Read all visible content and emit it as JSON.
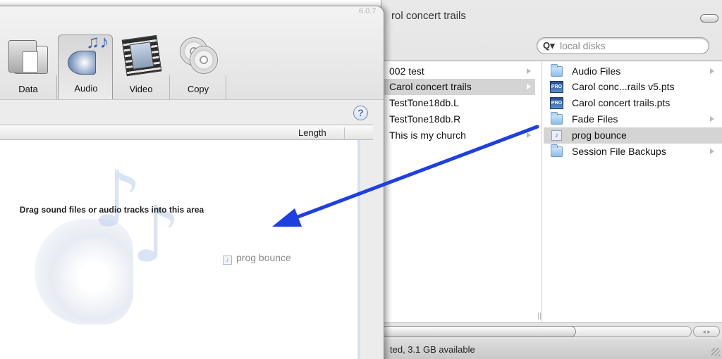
{
  "app": {
    "version": "6.0.7"
  },
  "finder": {
    "title": "rol concert trails",
    "search_placeholder": "local disks",
    "column1": [
      {
        "label": "002 test",
        "selected": false,
        "has_arrow": true
      },
      {
        "label": "Carol concert trails",
        "selected": true,
        "has_arrow": true
      },
      {
        "label": "TestTone18db.L",
        "selected": false,
        "has_arrow": false
      },
      {
        "label": "TestTone18db.R",
        "selected": false,
        "has_arrow": false
      },
      {
        "label": "This is my church",
        "selected": false,
        "has_arrow": true
      }
    ],
    "column2": [
      {
        "label": "Audio Files",
        "icon": "folder-icon",
        "selected": false,
        "has_arrow": true
      },
      {
        "label": "Carol conc...rails v5.pts",
        "icon": "protools-session-icon",
        "selected": false,
        "has_arrow": false
      },
      {
        "label": "Carol concert trails.pts",
        "icon": "protools-session-icon",
        "selected": false,
        "has_arrow": false
      },
      {
        "label": "Fade Files",
        "icon": "folder-icon",
        "selected": false,
        "has_arrow": true
      },
      {
        "label": "prog bounce",
        "icon": "audio-file-icon",
        "selected": true,
        "has_arrow": false
      },
      {
        "label": "Session File Backups",
        "icon": "folder-icon",
        "selected": false,
        "has_arrow": true
      }
    ],
    "status_text": "ted, 3.1 GB available",
    "scroll_buttons": "◂ ▸"
  },
  "burn": {
    "tabs": [
      {
        "label": "Data",
        "active": false
      },
      {
        "label": "Audio",
        "active": true
      },
      {
        "label": "Video",
        "active": false
      },
      {
        "label": "Copy",
        "active": false
      }
    ],
    "help_label": "?",
    "column_length": "Length",
    "drop_hint": "Drag sound files or audio tracks into this area",
    "dragging_item": "prog bounce"
  },
  "colors": {
    "drag_arrow": "#1f3fe0",
    "selection": "#d4d4d4"
  }
}
